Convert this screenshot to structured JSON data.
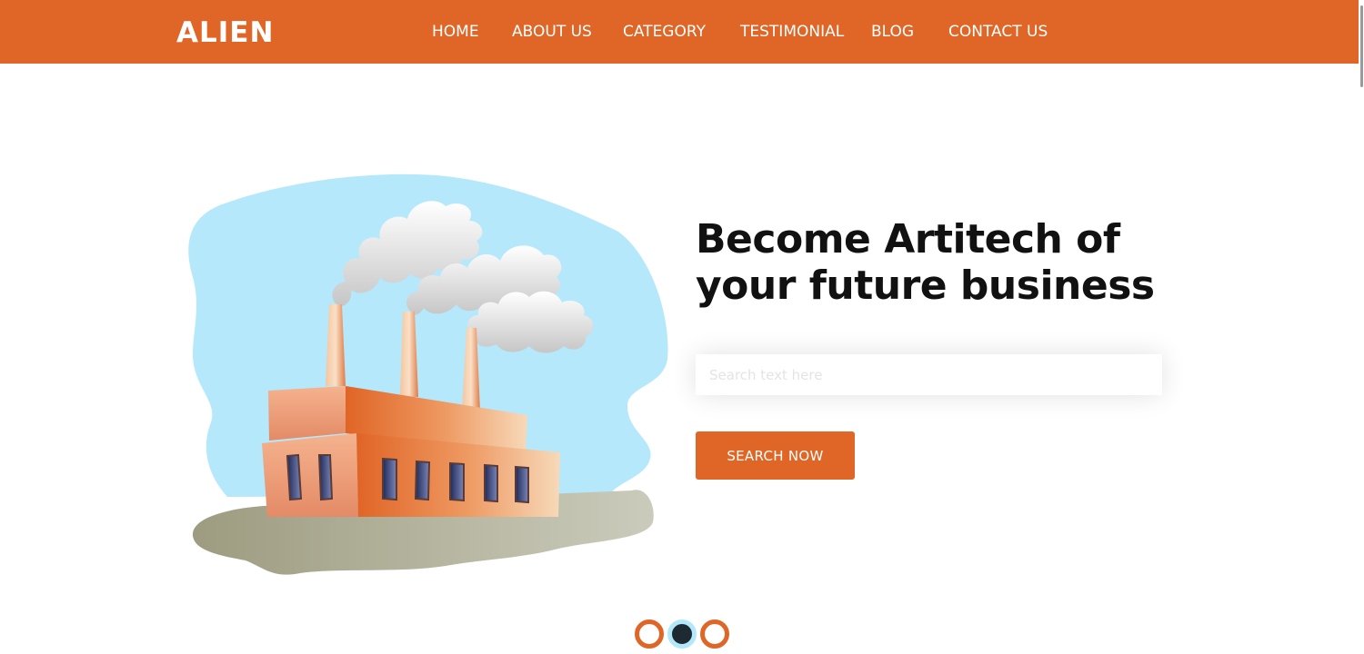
{
  "brand": {
    "logo": "ALIEN"
  },
  "nav": {
    "items": [
      {
        "label": "HOME"
      },
      {
        "label": "ABOUT US"
      },
      {
        "label": "CATEGORY"
      },
      {
        "label": "TESTIMONIAL"
      },
      {
        "label": "BLOG"
      },
      {
        "label": "CONTACT US"
      }
    ]
  },
  "hero": {
    "title_line1": "Become Artitech of",
    "title_line2": "your future business",
    "search": {
      "placeholder": "Search text here",
      "value": ""
    },
    "button_label": "SEARCH NOW",
    "illustration_icon": "factory-illustration"
  },
  "slider": {
    "slide_count": 3,
    "active_index": 1
  },
  "colors": {
    "accent": "#df6626",
    "sky": "#b5e8fb",
    "text_dark": "#111111",
    "dot_active": "#1e2a31"
  }
}
